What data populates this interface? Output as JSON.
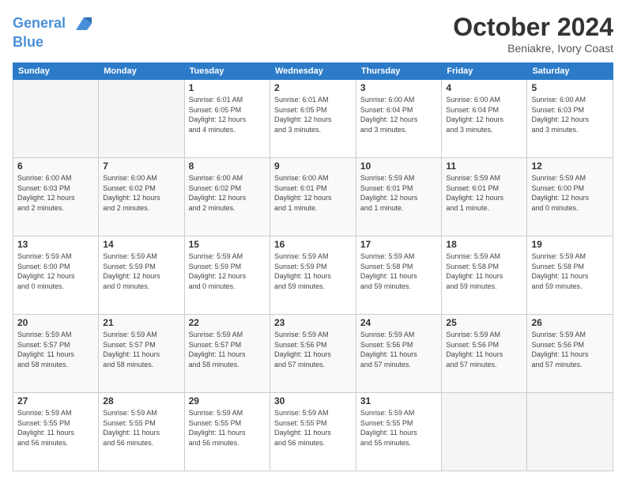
{
  "header": {
    "logo_line1": "General",
    "logo_line2": "Blue",
    "month": "October 2024",
    "location": "Beniakre, Ivory Coast"
  },
  "weekdays": [
    "Sunday",
    "Monday",
    "Tuesday",
    "Wednesday",
    "Thursday",
    "Friday",
    "Saturday"
  ],
  "weeks": [
    [
      {
        "day": "",
        "info": ""
      },
      {
        "day": "",
        "info": ""
      },
      {
        "day": "1",
        "info": "Sunrise: 6:01 AM\nSunset: 6:05 PM\nDaylight: 12 hours\nand 4 minutes."
      },
      {
        "day": "2",
        "info": "Sunrise: 6:01 AM\nSunset: 6:05 PM\nDaylight: 12 hours\nand 3 minutes."
      },
      {
        "day": "3",
        "info": "Sunrise: 6:00 AM\nSunset: 6:04 PM\nDaylight: 12 hours\nand 3 minutes."
      },
      {
        "day": "4",
        "info": "Sunrise: 6:00 AM\nSunset: 6:04 PM\nDaylight: 12 hours\nand 3 minutes."
      },
      {
        "day": "5",
        "info": "Sunrise: 6:00 AM\nSunset: 6:03 PM\nDaylight: 12 hours\nand 3 minutes."
      }
    ],
    [
      {
        "day": "6",
        "info": "Sunrise: 6:00 AM\nSunset: 6:03 PM\nDaylight: 12 hours\nand 2 minutes."
      },
      {
        "day": "7",
        "info": "Sunrise: 6:00 AM\nSunset: 6:02 PM\nDaylight: 12 hours\nand 2 minutes."
      },
      {
        "day": "8",
        "info": "Sunrise: 6:00 AM\nSunset: 6:02 PM\nDaylight: 12 hours\nand 2 minutes."
      },
      {
        "day": "9",
        "info": "Sunrise: 6:00 AM\nSunset: 6:01 PM\nDaylight: 12 hours\nand 1 minute."
      },
      {
        "day": "10",
        "info": "Sunrise: 5:59 AM\nSunset: 6:01 PM\nDaylight: 12 hours\nand 1 minute."
      },
      {
        "day": "11",
        "info": "Sunrise: 5:59 AM\nSunset: 6:01 PM\nDaylight: 12 hours\nand 1 minute."
      },
      {
        "day": "12",
        "info": "Sunrise: 5:59 AM\nSunset: 6:00 PM\nDaylight: 12 hours\nand 0 minutes."
      }
    ],
    [
      {
        "day": "13",
        "info": "Sunrise: 5:59 AM\nSunset: 6:00 PM\nDaylight: 12 hours\nand 0 minutes."
      },
      {
        "day": "14",
        "info": "Sunrise: 5:59 AM\nSunset: 5:59 PM\nDaylight: 12 hours\nand 0 minutes."
      },
      {
        "day": "15",
        "info": "Sunrise: 5:59 AM\nSunset: 5:59 PM\nDaylight: 12 hours\nand 0 minutes."
      },
      {
        "day": "16",
        "info": "Sunrise: 5:59 AM\nSunset: 5:59 PM\nDaylight: 11 hours\nand 59 minutes."
      },
      {
        "day": "17",
        "info": "Sunrise: 5:59 AM\nSunset: 5:58 PM\nDaylight: 11 hours\nand 59 minutes."
      },
      {
        "day": "18",
        "info": "Sunrise: 5:59 AM\nSunset: 5:58 PM\nDaylight: 11 hours\nand 59 minutes."
      },
      {
        "day": "19",
        "info": "Sunrise: 5:59 AM\nSunset: 5:58 PM\nDaylight: 11 hours\nand 59 minutes."
      }
    ],
    [
      {
        "day": "20",
        "info": "Sunrise: 5:59 AM\nSunset: 5:57 PM\nDaylight: 11 hours\nand 58 minutes."
      },
      {
        "day": "21",
        "info": "Sunrise: 5:59 AM\nSunset: 5:57 PM\nDaylight: 11 hours\nand 58 minutes."
      },
      {
        "day": "22",
        "info": "Sunrise: 5:59 AM\nSunset: 5:57 PM\nDaylight: 11 hours\nand 58 minutes."
      },
      {
        "day": "23",
        "info": "Sunrise: 5:59 AM\nSunset: 5:56 PM\nDaylight: 11 hours\nand 57 minutes."
      },
      {
        "day": "24",
        "info": "Sunrise: 5:59 AM\nSunset: 5:56 PM\nDaylight: 11 hours\nand 57 minutes."
      },
      {
        "day": "25",
        "info": "Sunrise: 5:59 AM\nSunset: 5:56 PM\nDaylight: 11 hours\nand 57 minutes."
      },
      {
        "day": "26",
        "info": "Sunrise: 5:59 AM\nSunset: 5:56 PM\nDaylight: 11 hours\nand 57 minutes."
      }
    ],
    [
      {
        "day": "27",
        "info": "Sunrise: 5:59 AM\nSunset: 5:55 PM\nDaylight: 11 hours\nand 56 minutes."
      },
      {
        "day": "28",
        "info": "Sunrise: 5:59 AM\nSunset: 5:55 PM\nDaylight: 11 hours\nand 56 minutes."
      },
      {
        "day": "29",
        "info": "Sunrise: 5:59 AM\nSunset: 5:55 PM\nDaylight: 11 hours\nand 56 minutes."
      },
      {
        "day": "30",
        "info": "Sunrise: 5:59 AM\nSunset: 5:55 PM\nDaylight: 11 hours\nand 56 minutes."
      },
      {
        "day": "31",
        "info": "Sunrise: 5:59 AM\nSunset: 5:55 PM\nDaylight: 11 hours\nand 55 minutes."
      },
      {
        "day": "",
        "info": ""
      },
      {
        "day": "",
        "info": ""
      }
    ]
  ]
}
